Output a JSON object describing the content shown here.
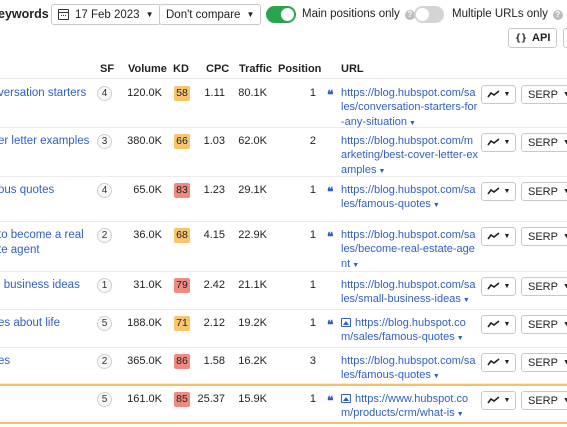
{
  "toolbar": {
    "title": "eywords",
    "date": "17 Feb 2023",
    "compare": "Don't compare",
    "main_positions_label": "Main positions only",
    "main_positions_on": true,
    "multiple_urls_label": "Multiple URLs only",
    "multiple_urls_on": false,
    "api_label": "API",
    "help_glyph": "?"
  },
  "columns": {
    "sf": "SF",
    "volume": "Volume",
    "kd": "KD",
    "cpc": "CPC",
    "traffic": "Traffic",
    "position": "Position",
    "url": "URL"
  },
  "serp_label": "SERP",
  "colors": {
    "link": "#2f5fc4",
    "kd_yellow": "#f9c46b",
    "kd_red": "#f08a80",
    "toggle_on": "#2aa44f",
    "highlight_border": "#f3c06b"
  },
  "rows": [
    {
      "keyword": [
        "versation starters"
      ],
      "sf": "4",
      "volume": "120.0K",
      "kd": "58",
      "kd_color": "#f9c46b",
      "cpc": "1.11",
      "traffic": "80.1K",
      "position": "1",
      "icons": [
        "quote-icon"
      ],
      "url_lines": [
        "https://blog.hubspot.com/sa",
        "les/conversation-starters-for",
        "-any-situation"
      ]
    },
    {
      "keyword": [
        "er letter examples"
      ],
      "sf": "3",
      "volume": "380.0K",
      "kd": "66",
      "kd_color": "#f9c46b",
      "cpc": "1.03",
      "traffic": "62.0K",
      "position": "2",
      "icons": [],
      "url_lines": [
        "https://blog.hubspot.com/m",
        "arketing/best-cover-letter-ex",
        "amples"
      ]
    },
    {
      "keyword": [
        "ous quotes"
      ],
      "sf": "4",
      "volume": "65.0K",
      "kd": "83",
      "kd_color": "#f08a80",
      "cpc": "1.23",
      "traffic": "29.1K",
      "position": "1",
      "icons": [
        "quote-icon"
      ],
      "url_lines": [
        "https://blog.hubspot.com/sa",
        "les/famous-quotes"
      ]
    },
    {
      "keyword": [
        "to become a real",
        "te agent"
      ],
      "sf": "2",
      "volume": "36.0K",
      "kd": "68",
      "kd_color": "#f9c46b",
      "cpc": "4.15",
      "traffic": "22.9K",
      "position": "1",
      "icons": [
        "quote-icon"
      ],
      "url_lines": [
        "https://blog.hubspot.com/sa",
        "les/become-real-estate-age",
        "nt"
      ]
    },
    {
      "keyword": [
        "l business ideas"
      ],
      "sf": "1",
      "volume": "31.0K",
      "kd": "79",
      "kd_color": "#f08a80",
      "cpc": "2.42",
      "traffic": "21.1K",
      "position": "1",
      "icons": [],
      "url_lines": [
        "https://blog.hubspot.com/sa",
        "les/small-business-ideas"
      ]
    },
    {
      "keyword": [
        "es about life"
      ],
      "sf": "5",
      "volume": "188.0K",
      "kd": "71",
      "kd_color": "#f9c46b",
      "cpc": "2.12",
      "traffic": "19.2K",
      "position": "1",
      "icons": [
        "quote-icon",
        "image-icon"
      ],
      "url_lines": [
        "https://blog.hubspot.co",
        "m/sales/famous-quotes"
      ]
    },
    {
      "keyword": [
        "es"
      ],
      "sf": "2",
      "volume": "365.0K",
      "kd": "86",
      "kd_color": "#f08a80",
      "cpc": "1.58",
      "traffic": "16.2K",
      "position": "3",
      "icons": [],
      "url_lines": [
        "https://blog.hubspot.com/sa",
        "les/famous-quotes"
      ]
    },
    {
      "keyword": [
        ""
      ],
      "sf": "5",
      "volume": "161.0K",
      "kd": "85",
      "kd_color": "#f08a80",
      "cpc": "25.37",
      "traffic": "15.9K",
      "position": "1",
      "icons": [
        "quote-icon",
        "image-icon"
      ],
      "url_lines": [
        "https://www.hubspot.co",
        "m/products/crm/what-is"
      ]
    }
  ]
}
